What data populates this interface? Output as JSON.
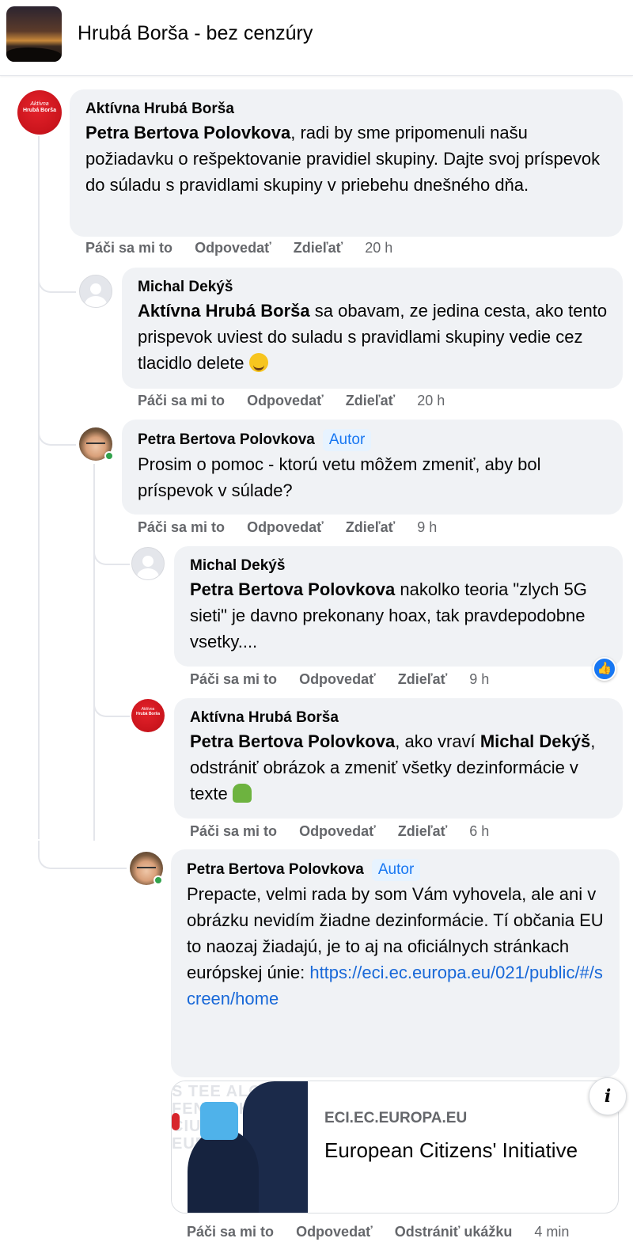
{
  "header": {
    "group_title": "Hrubá Borša - bez cenzúry"
  },
  "avatar_text": {
    "line1": "Aktívna",
    "line2": "Hrubá Borša"
  },
  "comments": [
    {
      "author": "Aktívna Hrubá Borša",
      "mention": "Petra Bertova Polovkova",
      "text": ", radi by sme pripomenuli našu požiadavku o rešpektovanie pravidiel skupiny. Dajte svoj príspevok do súladu s pravidlami skupiny v priebehu dnešného dňa.",
      "actions": {
        "like": "Páči sa mi to",
        "reply": "Odpovedať",
        "share": "Zdieľať",
        "time": "20 h"
      }
    },
    {
      "author": "Michal Dekýš",
      "mention": "Aktívna Hrubá Borša",
      "text": " sa obavam, ze jedina cesta, ako tento prispevok uviest do suladu s pravidlami skupiny vedie cez tlacidlo delete ",
      "actions": {
        "like": "Páči sa mi to",
        "reply": "Odpovedať",
        "share": "Zdieľať",
        "time": "20 h"
      }
    },
    {
      "author": "Petra Bertova Polovkova",
      "badge": "Autor",
      "text": "Prosim o pomoc - ktorú vetu môžem zmeniť, aby bol príspevok v súlade?",
      "actions": {
        "like": "Páči sa mi to",
        "reply": "Odpovedať",
        "share": "Zdieľať",
        "time": "9 h"
      }
    },
    {
      "author": "Michal Dekýš",
      "mention": "Petra Bertova Polovkova",
      "text": " nakolko teoria \"zlych 5G sieti\" je davno prekonany hoax, tak pravdepodobne vsetky....",
      "actions": {
        "like": "Páči sa mi to",
        "reply": "Odpovedať",
        "share": "Zdieľať",
        "time": "9 h"
      }
    },
    {
      "author": "Aktívna Hrubá Borša",
      "mention": "Petra Bertova Polovkova",
      "text_a": ", ako vraví ",
      "mention2": "Michal Dekýš",
      "text_b": ", odstrániť obrázok a zmeniť všetky dezinformácie v texte ",
      "actions": {
        "like": "Páči sa mi to",
        "reply": "Odpovedať",
        "share": "Zdieľať",
        "time": "6 h"
      }
    },
    {
      "author": "Petra Bertova Polovkova",
      "badge": "Autor",
      "text": "Prepacte, velmi rada by som Vám vyhovela, ale ani v obrázku nevidím žiadne dezinformácie. Tí občania EU to naozaj žiadajú, je to aj na oficiálnych stránkach európskej únie: ",
      "link": "https://eci.ec.europa.eu/021/public/#/screen/home",
      "actions": {
        "like": "Páči sa mi to",
        "reply": "Odpovedať",
        "remove_preview": "Odstrániť ukážku",
        "time": "4 min"
      }
    }
  ],
  "link_preview": {
    "domain": "ECI.EC.EUROPA.EU",
    "title": "European Citizens' Initiative",
    "image_text": "S TEE ALOITE FENSIV KEZD CIUDAD EUROPA"
  },
  "icons": {
    "like_badge": "thumbs-up-icon",
    "info": "info-icon",
    "emoji_1": "rolling-on-floor-laughing-emoji",
    "emoji_2": "person-shrugging-emoji"
  },
  "colors": {
    "link": "#1868d8",
    "badge": "#1877f2",
    "online": "#31a24c",
    "brand_red": "#c9141c"
  }
}
